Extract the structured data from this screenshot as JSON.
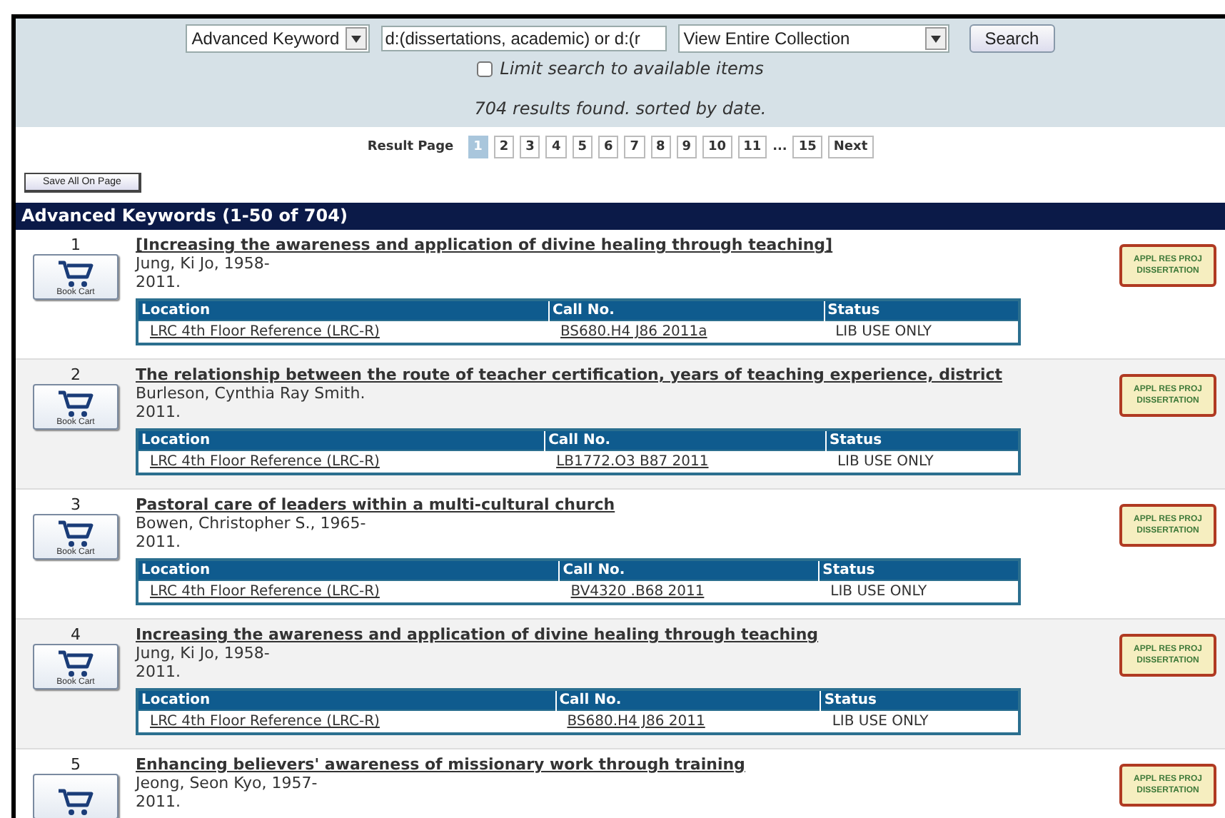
{
  "search": {
    "field_type": "Advanced Keyword",
    "query": "d:(dissertations, academic) or d:(r",
    "scope": "View Entire Collection",
    "button": "Search",
    "limit_label": "Limit search to available items",
    "limit_checked": false,
    "summary": "704 results found. sorted by date."
  },
  "pagination": {
    "label": "Result Page",
    "pages": [
      {
        "kind": "page",
        "label": "1",
        "selected": true
      },
      {
        "kind": "page",
        "label": "2",
        "selected": false
      },
      {
        "kind": "page",
        "label": "3",
        "selected": false
      },
      {
        "kind": "page",
        "label": "4",
        "selected": false
      },
      {
        "kind": "page",
        "label": "5",
        "selected": false
      },
      {
        "kind": "page",
        "label": "6",
        "selected": false
      },
      {
        "kind": "page",
        "label": "7",
        "selected": false
      },
      {
        "kind": "page",
        "label": "8",
        "selected": false
      },
      {
        "kind": "page",
        "label": "9",
        "selected": false
      },
      {
        "kind": "page",
        "label": "10",
        "selected": false
      },
      {
        "kind": "page",
        "label": "11",
        "selected": false
      },
      {
        "kind": "ellipsis",
        "label": "..."
      },
      {
        "kind": "page",
        "label": "15",
        "selected": false
      },
      {
        "kind": "page",
        "label": "Next",
        "selected": false
      }
    ]
  },
  "save_button": "Save All On Page",
  "results_header": "Advanced Keywords (1-50 of 704)",
  "records": [
    {
      "number": "1",
      "cart_label": "Book Cart",
      "title": "[Increasing the awareness and application of divine healing through teaching]",
      "author": "Jung, Ki Jo, 1958-",
      "year": "2011.",
      "badge": [
        "APPL RES PROJ",
        "DISSERTATION"
      ],
      "holdings": {
        "columns": [
          "Location",
          "Call No.",
          "Status"
        ],
        "rows": [
          [
            "LRC 4th Floor Reference (LRC-R)",
            "BS680.H4 J86 2011a",
            "LIB USE ONLY"
          ]
        ]
      }
    },
    {
      "number": "2",
      "cart_label": "Book Cart",
      "title": "The relationship between the route of teacher certification, years of teaching experience, district",
      "author": "Burleson, Cynthia Ray Smith.",
      "year": "2011.",
      "badge": [
        "APPL RES PROJ",
        "DISSERTATION"
      ],
      "holdings": {
        "columns": [
          "Location",
          "Call No.",
          "Status"
        ],
        "rows": [
          [
            "LRC 4th Floor Reference (LRC-R)",
            "LB1772.O3 B87 2011",
            "LIB USE ONLY"
          ]
        ]
      }
    },
    {
      "number": "3",
      "cart_label": "Book Cart",
      "title": "Pastoral care of leaders within a multi-cultural church",
      "author": "Bowen, Christopher S., 1965-",
      "year": "2011.",
      "badge": [
        "APPL RES PROJ",
        "DISSERTATION"
      ],
      "holdings": {
        "columns": [
          "Location",
          "Call No.",
          "Status"
        ],
        "rows": [
          [
            "LRC 4th Floor Reference (LRC-R)",
            "BV4320 .B68 2011",
            "LIB USE ONLY"
          ]
        ]
      }
    },
    {
      "number": "4",
      "cart_label": "Book Cart",
      "title": "Increasing the awareness and application of divine healing through teaching",
      "author": "Jung, Ki Jo, 1958-",
      "year": "2011.",
      "badge": [
        "APPL RES PROJ",
        "DISSERTATION"
      ],
      "holdings": {
        "columns": [
          "Location",
          "Call No.",
          "Status"
        ],
        "rows": [
          [
            "LRC 4th Floor Reference (LRC-R)",
            "BS680.H4 J86 2011",
            "LIB USE ONLY"
          ]
        ]
      }
    },
    {
      "number": "5",
      "title": "Enhancing believers' awareness of missionary work through training",
      "author": "Jeong, Seon Kyo, 1957-",
      "year": "2011.",
      "badge": [
        "APPL RES PROJ",
        "DISSERTATION"
      ]
    }
  ]
}
